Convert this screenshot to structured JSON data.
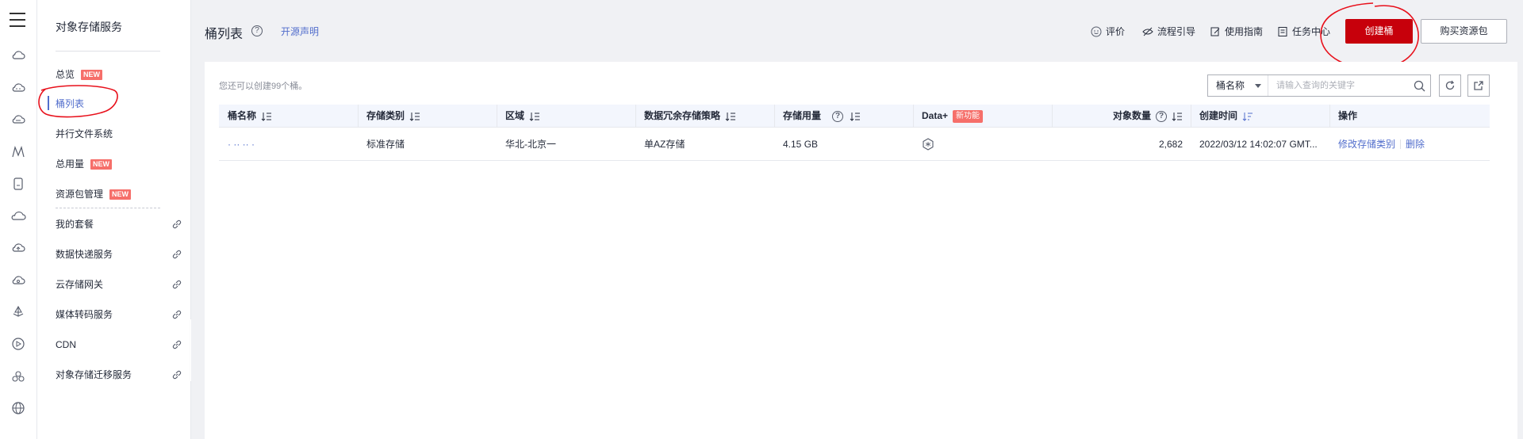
{
  "menu": {
    "title": "对象存储服务",
    "items": [
      {
        "label": "总览",
        "badge": "NEW"
      },
      {
        "label": "桶列表",
        "badge": ""
      },
      {
        "label": "并行文件系统",
        "badge": ""
      },
      {
        "label": "总用量",
        "badge": "NEW"
      },
      {
        "label": "资源包管理",
        "badge": "NEW"
      },
      {
        "label": "我的套餐",
        "badge": ""
      },
      {
        "label": "数据快递服务",
        "badge": ""
      },
      {
        "label": "云存储网关",
        "badge": ""
      },
      {
        "label": "媒体转码服务",
        "badge": ""
      },
      {
        "label": "CDN",
        "badge": ""
      },
      {
        "label": "对象存储迁移服务",
        "badge": ""
      }
    ]
  },
  "header": {
    "title": "桶列表",
    "help": "?",
    "open_source": "开源声明",
    "toolbar": {
      "rate": "评价",
      "guide": "流程引导",
      "manual": "使用指南",
      "tasks": "任务中心"
    },
    "create_button": "创建桶",
    "buy_button": "购买资源包"
  },
  "panel": {
    "info": "您还可以创建99个桶。",
    "search": {
      "select_value": "桶名称",
      "placeholder": "请输入查询的关键字"
    }
  },
  "table": {
    "columns": [
      "桶名称",
      "存储类别",
      "区域",
      "数据冗余存储策略",
      "存储用量",
      "Data+",
      "对象数量",
      "创建时间",
      "操作"
    ],
    "new_feature_badge": "新功能",
    "rows": [
      {
        "name": "·  ··  ·· ·",
        "storage_class": "标准存储",
        "region": "华北-北京一",
        "redundancy": "单AZ存储",
        "usage": "4.15 GB",
        "objects": "2,682",
        "created": "2022/03/12 14:02:07 GMT...",
        "op_modify": "修改存储类别",
        "op_delete": "删除"
      }
    ]
  },
  "colors": {
    "accent": "#526ecc",
    "primary_red": "#c7000b",
    "badge_red": "#f66f6a",
    "annotation_red": "#e8101b"
  }
}
